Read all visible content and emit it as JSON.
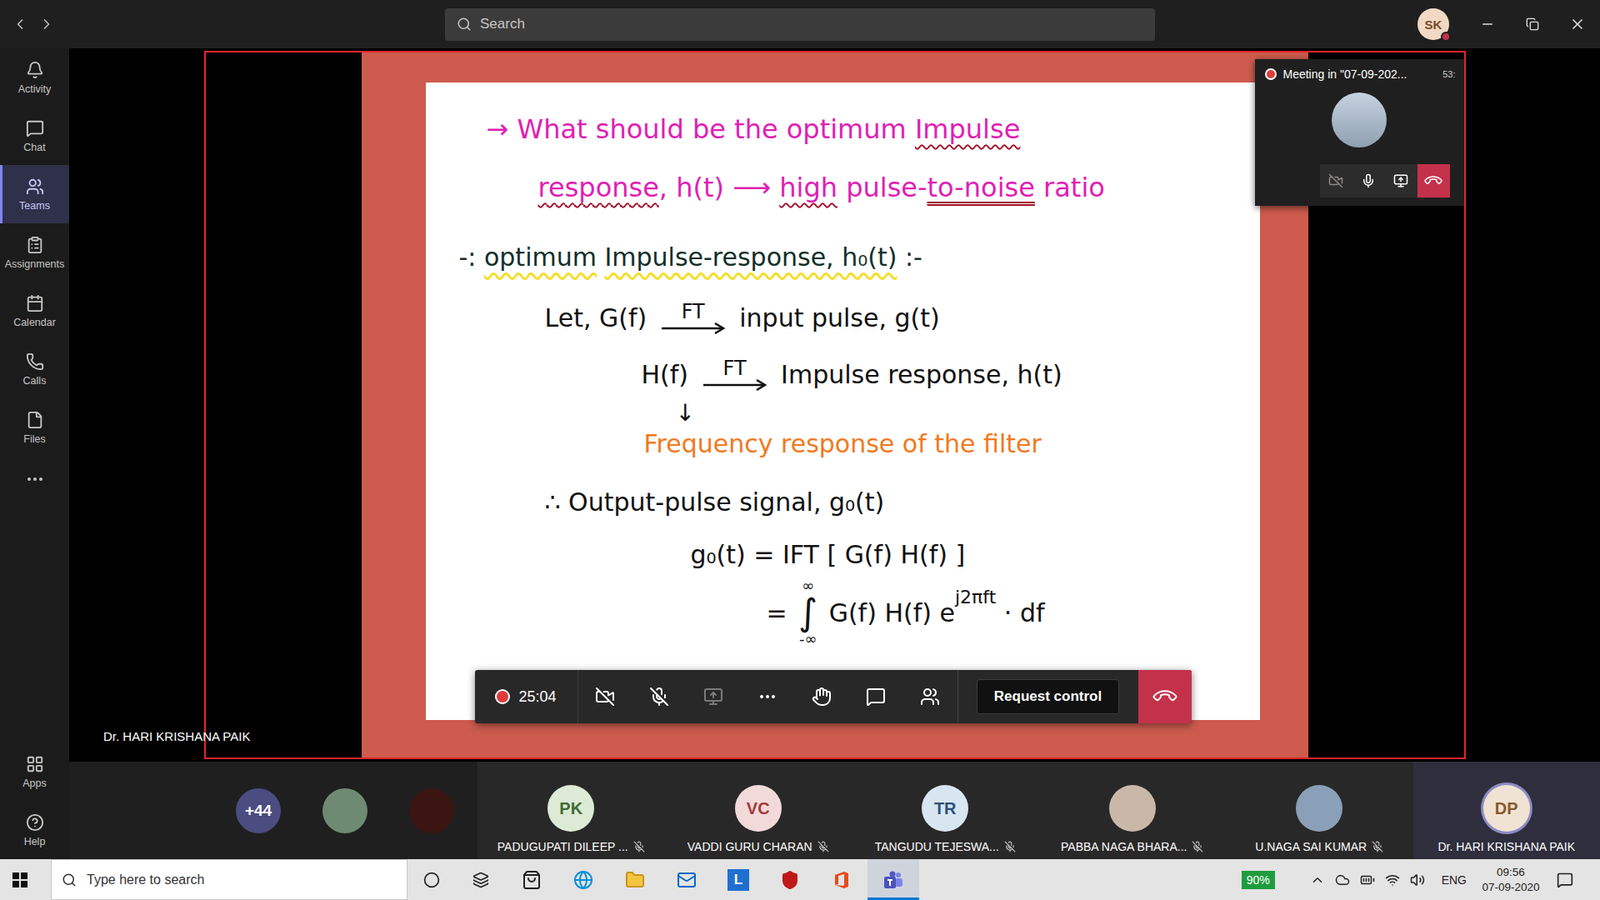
{
  "topbar": {
    "search": {
      "placeholder": "Search"
    },
    "account": {
      "initials": "SK",
      "status_busy": true
    }
  },
  "rail": {
    "items": [
      {
        "label": "Activity",
        "selected": false
      },
      {
        "label": "Chat",
        "selected": false
      },
      {
        "label": "Teams",
        "selected": true
      },
      {
        "label": "Assignments",
        "selected": false
      },
      {
        "label": "Calendar",
        "selected": false
      },
      {
        "label": "Calls",
        "selected": false
      },
      {
        "label": "Files",
        "selected": false
      }
    ],
    "bottom_items": [
      {
        "label": "Apps"
      },
      {
        "label": "Help"
      }
    ]
  },
  "stage": {
    "presenter": "Dr. HARI KRISHANA PAIK",
    "page": {
      "lines": [
        {
          "kind": "heading",
          "color": "#e01fb4",
          "segments": [
            {
              "kind": "text",
              "text": "→ What should be the optimum ",
              "underline": "none"
            },
            {
              "kind": "text",
              "text": "Impulse",
              "underline": "wavy"
            }
          ]
        },
        {
          "kind": "heading-cont",
          "color": "#e01fb4",
          "segments": [
            {
              "kind": "text",
              "text": "response",
              "underline": "wavy"
            },
            {
              "kind": "text",
              "text": ", h(t) ⟶ ",
              "underline": "none"
            },
            {
              "kind": "text",
              "text": "high",
              "underline": "wavy"
            },
            {
              "kind": "text",
              "text": " pulse-",
              "underline": "none"
            },
            {
              "kind": "text",
              "text": "to-noise",
              "underline": "double"
            },
            {
              "kind": "text",
              "text": " ratio",
              "underline": "none"
            }
          ]
        },
        {
          "kind": "section",
          "color": "#12302a",
          "segments": [
            {
              "kind": "text",
              "text": "-: ",
              "underline": "none"
            },
            {
              "kind": "text",
              "text": "optimum",
              "underline": "highlight"
            },
            {
              "kind": "text",
              "text": " ",
              "underline": "none"
            },
            {
              "kind": "text",
              "text": "Impulse-response, h₀(t)",
              "underline": "highlight"
            },
            {
              "kind": "text",
              "text": " :-",
              "underline": "none"
            }
          ]
        },
        {
          "kind": "definition",
          "color": "#111111",
          "segments": [
            {
              "kind": "text",
              "text": "Let, G(f) ",
              "underline": "none"
            },
            {
              "kind": "transform",
              "text": "FT",
              "underline": "none"
            },
            {
              "kind": "text",
              "text": " input pulse, g(t)",
              "underline": "none"
            }
          ]
        },
        {
          "kind": "sub-definition",
          "color": "#111111",
          "segments": [
            {
              "kind": "text",
              "text": "H(f) ",
              "underline": "none"
            },
            {
              "kind": "transform",
              "text": "FT",
              "underline": "none"
            },
            {
              "kind": "text",
              "text": " Impulse response, h(t)",
              "underline": "none"
            }
          ]
        },
        {
          "kind": "pointer",
          "color": "#111111",
          "segments": [
            {
              "kind": "text",
              "text": "↓",
              "underline": "none"
            }
          ]
        },
        {
          "kind": "note",
          "color": "#f07a22",
          "segments": [
            {
              "kind": "text",
              "text": "Frequency response of the filter",
              "underline": "none"
            }
          ]
        },
        {
          "kind": "definition",
          "color": "#111111",
          "segments": [
            {
              "kind": "text",
              "text": "∴ Output-pulse signal, g₀(t)",
              "underline": "none"
            }
          ]
        },
        {
          "kind": "equation",
          "color": "#111111",
          "segments": [
            {
              "kind": "text",
              "text": "g₀(t) = IFT [ G(f) H(f) ]",
              "underline": "none"
            }
          ]
        },
        {
          "kind": "integral",
          "color": "#111111",
          "segments": [
            {
              "kind": "text",
              "text": "= ",
              "underline": "none"
            },
            {
              "kind": "integral",
              "symbol": "∫",
              "upper": "∞",
              "lower": "-∞"
            },
            {
              "kind": "text",
              "text": " G(f) H(f) e",
              "underline": "none"
            },
            {
              "kind": "power",
              "text": "j2πft",
              "underline": "none"
            },
            {
              "kind": "text",
              "text": " · df",
              "underline": "none"
            }
          ]
        }
      ]
    },
    "meeting_window": {
      "recording": true,
      "title": "Meeting in \"07-09-202...",
      "timer": "53:",
      "camera_on": false,
      "mic_on": true
    },
    "call_controls": {
      "recording": true,
      "elapsed": "25:04",
      "camera_on": false,
      "mic_on": false,
      "share_disabled": true,
      "request_control": "Request control"
    }
  },
  "participants": {
    "overflow": "+44",
    "thumbnails": [
      {
        "color": "#6f8a72"
      },
      {
        "color": "#3a1512"
      }
    ],
    "tiles": [
      {
        "kind": "initials",
        "initials": "PK",
        "name": "PADUGUPATI DILEEP ...",
        "muted": true,
        "speaking": false,
        "color": "#dcead6",
        "text_color": "#3f6b38"
      },
      {
        "kind": "initials",
        "initials": "VC",
        "name": "VADDI GURU CHARAN",
        "muted": true,
        "speaking": false,
        "color": "#f3dada",
        "text_color": "#a33a3a"
      },
      {
        "kind": "initials",
        "initials": "TR",
        "name": "TANGUDU TEJESWA...",
        "muted": true,
        "speaking": false,
        "color": "#d8e6f1",
        "text_color": "#2c5179"
      },
      {
        "kind": "photo",
        "initials": "",
        "name": "PABBA NAGA BHARA...",
        "muted": true,
        "speaking": false,
        "color": "#c9b8a8",
        "text_color": "#000000"
      },
      {
        "kind": "photo",
        "initials": "",
        "name": "U.NAGA SAI KUMAR",
        "muted": true,
        "speaking": false,
        "color": "#8aa0b8",
        "text_color": "#000000"
      },
      {
        "kind": "initials",
        "initials": "DP",
        "name": "Dr. HARI KRISHANA PAIK",
        "muted": false,
        "speaking": true,
        "color": "#f1e3d3",
        "text_color": "#8a5a2d"
      }
    ]
  },
  "taskbar": {
    "search": {
      "placeholder": "Type here to search"
    },
    "pinned": [
      {
        "kind": "store",
        "label": "",
        "active": false
      },
      {
        "kind": "edge",
        "label": "",
        "active": false
      },
      {
        "kind": "explorer",
        "label": "",
        "active": false
      },
      {
        "kind": "mail",
        "label": "",
        "active": false
      },
      {
        "kind": "letter",
        "label": "L",
        "active": false
      },
      {
        "kind": "mcafee",
        "label": "",
        "active": false
      },
      {
        "kind": "office",
        "label": "",
        "active": false
      },
      {
        "kind": "teams",
        "label": "",
        "active": true
      }
    ],
    "battery": "90%",
    "language": "ENG",
    "time": "09:56",
    "date": "07-09-2020"
  }
}
